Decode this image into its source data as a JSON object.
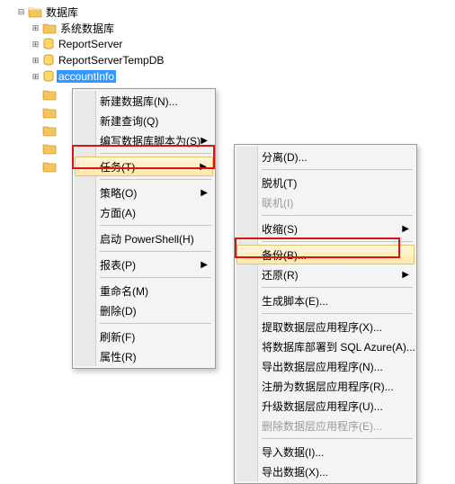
{
  "tree": {
    "root_label": "数据库",
    "nodes": [
      {
        "label": "系统数据库",
        "type": "folder"
      },
      {
        "label": "ReportServer",
        "type": "db"
      },
      {
        "label": "ReportServerTempDB",
        "type": "db"
      },
      {
        "label": "accountInfo",
        "type": "db",
        "selected": true
      }
    ]
  },
  "menu1": {
    "items": [
      {
        "label": "新建数据库(N)...",
        "arrow": false
      },
      {
        "label": "新建查询(Q)",
        "arrow": false
      },
      {
        "label": "编写数据库脚本为(S)",
        "arrow": true
      },
      {
        "sep": true
      },
      {
        "label": "任务(T)",
        "arrow": true,
        "highlight": true
      },
      {
        "sep": true
      },
      {
        "label": "策略(O)",
        "arrow": true
      },
      {
        "label": "方面(A)",
        "arrow": false
      },
      {
        "sep": true
      },
      {
        "label": "启动 PowerShell(H)",
        "arrow": false
      },
      {
        "sep": true
      },
      {
        "label": "报表(P)",
        "arrow": true
      },
      {
        "sep": true
      },
      {
        "label": "重命名(M)",
        "arrow": false
      },
      {
        "label": "删除(D)",
        "arrow": false
      },
      {
        "sep": true
      },
      {
        "label": "刷新(F)",
        "arrow": false
      },
      {
        "label": "属性(R)",
        "arrow": false
      }
    ]
  },
  "menu2": {
    "items": [
      {
        "label": "分离(D)...",
        "arrow": false
      },
      {
        "sep": true
      },
      {
        "label": "脱机(T)",
        "arrow": false
      },
      {
        "label": "联机(I)",
        "arrow": false,
        "disabled": true
      },
      {
        "sep": true
      },
      {
        "label": "收缩(S)",
        "arrow": true
      },
      {
        "sep": true
      },
      {
        "label": "备份(B)...",
        "arrow": false,
        "highlight": true
      },
      {
        "label": "还原(R)",
        "arrow": true
      },
      {
        "sep": true
      },
      {
        "label": "生成脚本(E)...",
        "arrow": false
      },
      {
        "sep": true
      },
      {
        "label": "提取数据层应用程序(X)...",
        "arrow": false
      },
      {
        "label": "将数据库部署到 SQL Azure(A)...",
        "arrow": false
      },
      {
        "label": "导出数据层应用程序(N)...",
        "arrow": false
      },
      {
        "label": "注册为数据层应用程序(R)...",
        "arrow": false
      },
      {
        "label": "升级数据层应用程序(U)...",
        "arrow": false
      },
      {
        "label": "删除数据层应用程序(E)...",
        "arrow": false,
        "disabled": true
      },
      {
        "sep": true
      },
      {
        "label": "导入数据(I)...",
        "arrow": false
      },
      {
        "label": "导出数据(X)...",
        "arrow": false
      }
    ]
  },
  "glyphs": {
    "arrow": "▶",
    "minus": "⊟",
    "plus": "⊞"
  }
}
